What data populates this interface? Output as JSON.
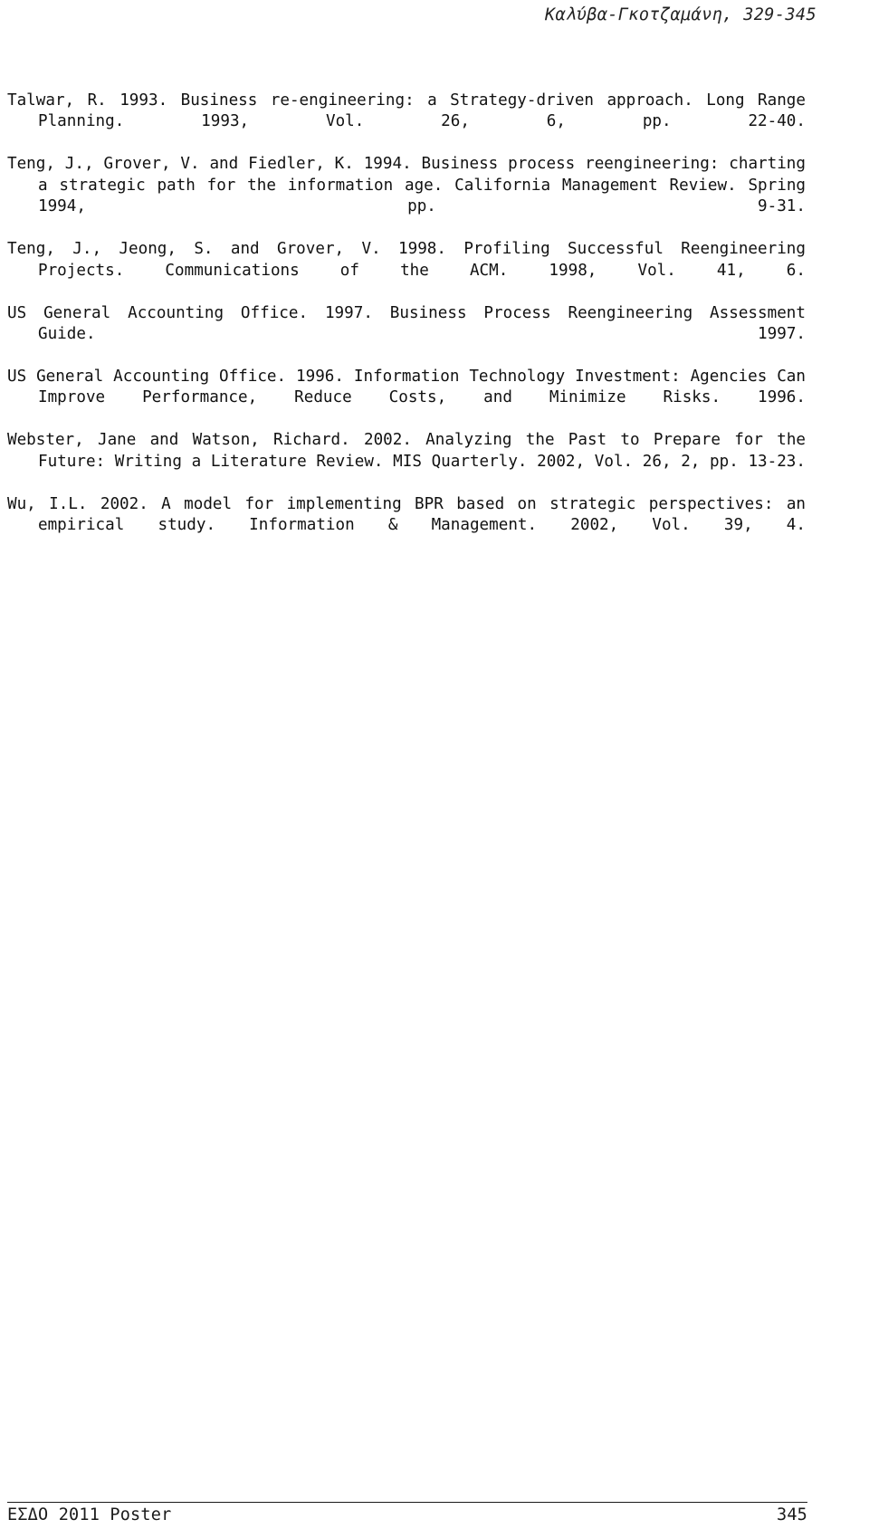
{
  "page": {
    "running_header": "Καλύβα-Γκοτζαμάνη, 329-345",
    "footer_left": "ΕΣΔΟ 2011 Poster",
    "footer_right": "345",
    "text_color": "#111111",
    "background_color": "#ffffff"
  },
  "references": [
    {
      "id": "ref-talwar-1993",
      "text": "Talwar, R. 1993. Business re-engineering: a Strategy-driven approach. Long Range Planning. 1993, Vol. 26, 6, pp. 22-40."
    },
    {
      "id": "ref-teng-grover-fiedler-1994",
      "text": "Teng, J., Grover, V. and Fiedler, K. 1994. Business process reengineering: charting a strategic path for the information age. California Management Review. Spring 1994, pp. 9-31."
    },
    {
      "id": "ref-teng-jeong-grover-1998",
      "text": "Teng, J., Jeong, S. and Grover, V. 1998. Profiling Successful Reengineering Projects. Communications of the ACM. 1998, Vol. 41, 6."
    },
    {
      "id": "ref-usgao-1997",
      "text": "US General Accounting Office. 1997. Business Process Reengineering Assessment Guide. 1997."
    },
    {
      "id": "ref-usgao-1996",
      "text": "US General Accounting Office. 1996. Information Technology Investment: Agencies Can Improve Performance, Reduce Costs, and Minimize Risks. 1996."
    },
    {
      "id": "ref-webster-watson-2002",
      "text": "Webster, Jane and Watson, Richard. 2002. Analyzing the Past to Prepare for the Future: Writing a Literature Review. MIS Quarterly. 2002, Vol. 26, 2, pp. 13-23."
    },
    {
      "id": "ref-wu-2002",
      "text": "Wu, I.L. 2002. A model for implementing BPR based on strategic perspectives: an empirical study. Information & Management. 2002, Vol. 39, 4."
    }
  ]
}
